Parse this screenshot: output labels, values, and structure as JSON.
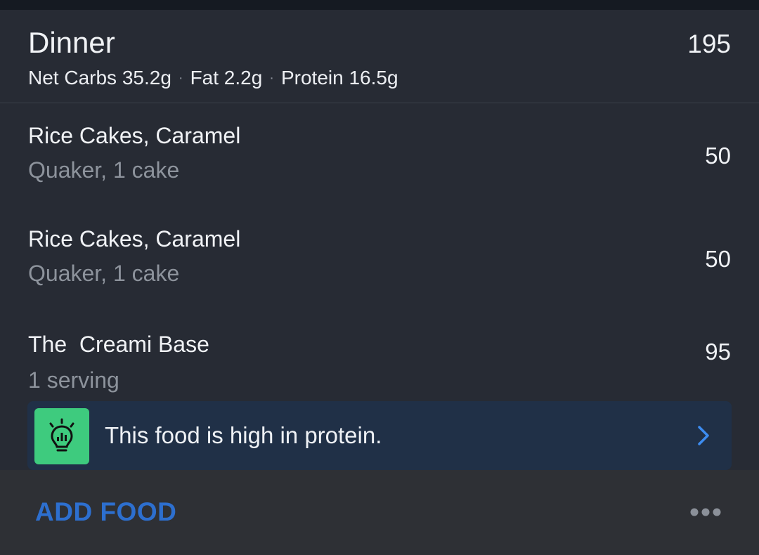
{
  "meal": {
    "title": "Dinner",
    "calories": "195",
    "macros": {
      "net_carbs": "Net Carbs 35.2g",
      "fat": "Fat 2.2g",
      "protein": "Protein 16.5g",
      "separator": "·"
    }
  },
  "foods": [
    {
      "name": "Rice Cakes, Caramel",
      "detail": "Quaker, 1 cake",
      "calories": "50"
    },
    {
      "name": "Rice Cakes, Caramel",
      "detail": "Quaker, 1 cake",
      "calories": "50"
    },
    {
      "name": "The  Creami Base",
      "detail": "1 serving",
      "calories": "95"
    }
  ],
  "insight": {
    "icon": "lightbulb-icon",
    "text": "This food is high in protein.",
    "chevron": "chevron-right-icon"
  },
  "footer": {
    "add_food_label": "ADD FOOD",
    "more_icon": "more-horizontal-icon"
  },
  "colors": {
    "background": "#272b34",
    "accent_blue": "#2d6fcf",
    "insight_bg": "#203047",
    "insight_icon_bg": "#3ecb7e",
    "footer_bg": "#2e3035"
  }
}
